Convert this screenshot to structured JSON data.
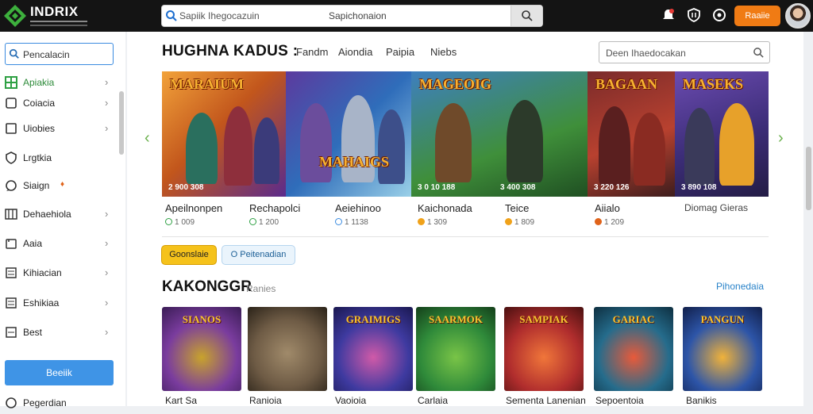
{
  "header": {
    "logo_text": "INDRIX",
    "search_query": "Sapiik Ihegocazuin",
    "search_hint": "Sapichonaion",
    "login_label": "Raaiie",
    "icons": [
      "bell-icon",
      "shield-icon",
      "coin-icon"
    ]
  },
  "sidebar": {
    "search_placeholder": "Pencalacin",
    "items": [
      {
        "label": "Apiakia",
        "icon": "grid-icon",
        "active": true
      },
      {
        "label": "Coiacia",
        "icon": "square-icon"
      },
      {
        "label": "Uiobies",
        "icon": "square-icon"
      },
      {
        "label": "Lrgtkia",
        "icon": "shield-icon"
      },
      {
        "label": "Siaign",
        "icon": "chat-icon"
      },
      {
        "label": "Dehaehiola",
        "icon": "chart-icon"
      },
      {
        "label": "Aaia",
        "icon": "folder-icon"
      },
      {
        "label": "Kihiacian",
        "icon": "list-icon"
      },
      {
        "label": "Eshikiaa",
        "icon": "list-icon"
      },
      {
        "label": "Best",
        "icon": "list-icon"
      }
    ],
    "cta_label": "Beeiik",
    "bottom_label": "Pegerdian"
  },
  "featured": {
    "title": "HUGHNA KADUS :",
    "tabs": [
      "Fandm",
      "Aiondia",
      "Paipia",
      "Niebs"
    ],
    "search_placeholder": "Deen Ihaedocakan",
    "banners": [
      {
        "title": "MARAIUM",
        "caption": "2 900 308",
        "color": "#c2561c"
      },
      {
        "title": "MAHAIGS",
        "caption": "",
        "color": "#7b3fa0"
      },
      {
        "title": "MAGEOIG",
        "caption": "3 0 10 188",
        "color": "#3f8f3a"
      },
      {
        "title": "",
        "caption": "3 400 308",
        "color": "#2d6a48"
      },
      {
        "title": "BAGAAN",
        "caption": "3 220 126",
        "color": "#9c2a2a"
      },
      {
        "title": "MASEKS",
        "caption": "3 890 108",
        "color": "#5a3d8c"
      }
    ],
    "games": [
      {
        "name": "Apeilnonpen",
        "meta": "1 009",
        "dot": "#2ea043"
      },
      {
        "name": "Rechapolci",
        "meta": "1 200",
        "dot": "#2ea043"
      },
      {
        "name": "Aeiehinoo",
        "meta": "1 1138",
        "dot": "#3a8be0"
      },
      {
        "name": "Kaichonada",
        "meta": "1 309",
        "dot": "#f0a21a"
      },
      {
        "name": "Teice",
        "meta": "1 809",
        "dot": "#f0a21a"
      },
      {
        "name": "Aiialo",
        "meta": "1 209",
        "dot": "#e0631a"
      },
      {
        "name": "Diomag Gieras",
        "meta": "",
        "dot": ""
      }
    ],
    "chips": [
      "Goonslaie",
      "O Peitenadian"
    ]
  },
  "categories": {
    "title": "KAKONGGR",
    "subtitle": "Ranies",
    "link": "Pihonedaia",
    "cards": [
      {
        "title": "SIANOS",
        "label": "Kart Sa",
        "bg": "#7a3c9e"
      },
      {
        "title": "",
        "label": "Ranioia",
        "bg": "#6e5b45"
      },
      {
        "title": "GRAIMIGS",
        "label": "Vaoioia",
        "bg": "#3e3aa0"
      },
      {
        "title": "SAARMOK",
        "label": "Carlaia",
        "bg": "#2f8a3a"
      },
      {
        "title": "SAMPIAK",
        "label": "Sementa Lanenian",
        "bg": "#b02d2d"
      },
      {
        "title": "GARIAC",
        "label": "Sepoentoia",
        "bg": "#256c8c"
      },
      {
        "title": "PANGUN",
        "label": "Banikis",
        "bg": "#2d55a8"
      }
    ]
  }
}
